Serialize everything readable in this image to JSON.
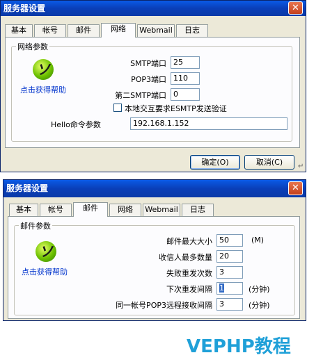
{
  "dialog1": {
    "title": "服务器设置",
    "close_glyph": "✕",
    "tabs": [
      "基本",
      "帐号",
      "邮件",
      "网络",
      "Webmail",
      "日志"
    ],
    "active_tab": "网络",
    "group_label": "网络参数",
    "help_link": "点击获得帮助",
    "help_logo_glyph": "ソ",
    "fields": {
      "smtp_port_label": "SMTP端口",
      "smtp_port_value": "25",
      "pop3_port_label": "POP3端口",
      "pop3_port_value": "110",
      "second_smtp_label": "第二SMTP端口",
      "second_smtp_value": "0",
      "esmtp_checkbox_label": "本地交互要求ESMTP发送验证",
      "esmtp_checked": false,
      "hello_label": "Hello命令参数",
      "hello_value": "192.168.1.152"
    },
    "buttons": {
      "ok": "确定(O)",
      "cancel": "取消(C)"
    },
    "return_mark": "↵"
  },
  "dialog2": {
    "title": "服务器设置",
    "close_glyph": "✕",
    "tabs": [
      "基本",
      "帐号",
      "邮件",
      "网络",
      "Webmail",
      "日志"
    ],
    "active_tab": "邮件",
    "group_label": "邮件参数",
    "help_link": "点击获得帮助",
    "help_logo_glyph": "ソ",
    "fields": {
      "max_size_label": "邮件最大大小",
      "max_size_value": "50",
      "max_size_unit": "(M)",
      "max_recipients_label": "收信人最多数量",
      "max_recipients_value": "20",
      "retry_count_label": "失败重发次数",
      "retry_count_value": "3",
      "retry_interval_label": "下次重发间隔",
      "retry_interval_value": "1",
      "retry_interval_unit": "(分钟)",
      "pop3_interval_label": "同一帐号POP3远程接收间隔",
      "pop3_interval_value": "3",
      "pop3_interval_unit": "(分钟)"
    }
  },
  "watermark": "VEPHP教程",
  "colors": {
    "titlebar": "#0a46c8",
    "dialog_bg": "#ece9d8",
    "panel_bg": "#fcfcfe",
    "link": "#0033cc",
    "watermark": "#1fa0d8",
    "close": "#d9542a"
  }
}
